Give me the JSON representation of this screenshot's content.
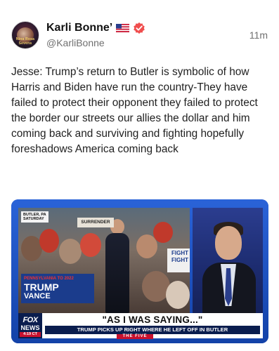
{
  "post": {
    "author": {
      "display_name": "Karli Bonne’",
      "handle": "@KarliBonne",
      "avatar_label": "Nina Rosa Sevens",
      "flag_icon": "us-flag-icon",
      "verified_icon": "verified-badge-icon",
      "verified_color": "#f04e4e"
    },
    "timestamp": "11m",
    "text": "Jesse: Trump’s return to Butler is symbolic of how Harris and Biden have run the country-They have\nfailed to protect their opponent they failed to protect the border our streets our allies the dollar and him coming back and surviving and fighting hopefully foreshadows America coming back"
  },
  "media": {
    "dateline": "BUTLER, PA\nSATURDAY",
    "rally_sign_top": "PENNSYLVANIA TO 2022",
    "rally_sign_trump": "TRUMP",
    "rally_sign_vance": "VANCE",
    "rally_sign_year": "2024",
    "sign_surrender": "SURRENDER",
    "sign_fight": "FIGHT FIGHT",
    "fox_logo_top": "FOX",
    "fox_logo_bottom": "NEWS",
    "fox_time": "4:19 CT",
    "headline": "\"AS I WAS SAYING...\"",
    "subheadline": "TRUMP PICKS UP RIGHT WHERE HE LEFT OFF IN BUTLER",
    "show_name": "THE FIVE"
  }
}
